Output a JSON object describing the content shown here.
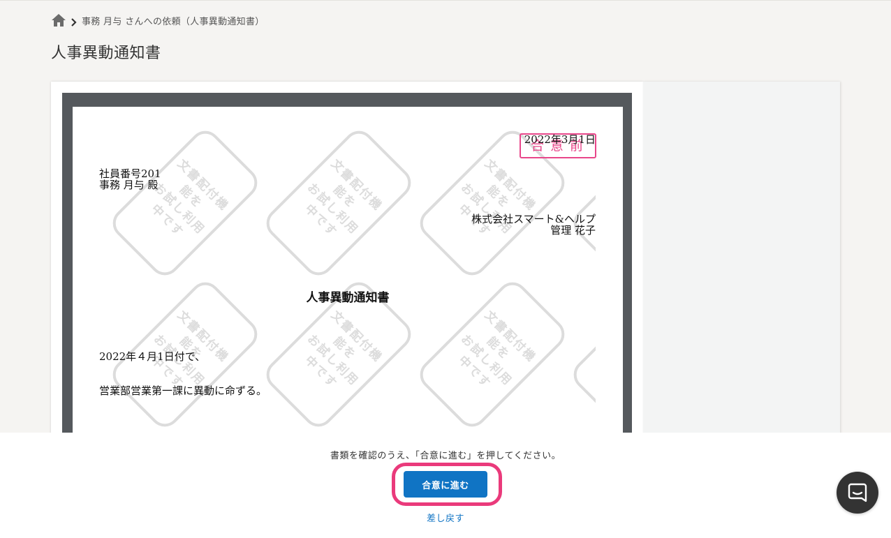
{
  "breadcrumb": {
    "home_icon": "home-icon",
    "separator_icon": "chevron-right-icon",
    "current": "事務 月与 さんへの依頼（人事異動通知書）"
  },
  "page": {
    "title": "人事異動通知書"
  },
  "document": {
    "stamp": "合意前",
    "date": "2022年3月1日",
    "employee_number": "社員番号201",
    "employee_name": "事務 月与 殿",
    "company": "株式会社スマート&ヘルプ",
    "manager": "管理 花子",
    "heading": "人事異動通知書",
    "effective_date_line": "2022年４月1日付で、",
    "order_line": "営業部営業第一課に異動に命ずる。",
    "watermark_line1": "文書配付機能を",
    "watermark_line2": "お試し利用中です",
    "stamp_color": "#e8468a"
  },
  "footer": {
    "message": "書類を確認のうえ、「合意に進む」を押してください。",
    "agree_button": "合意に進む",
    "return_link": "差し戻す",
    "accent_color": "#1074c4",
    "highlight_color": "#ea3a7b"
  },
  "chat": {
    "icon": "chat-bubble-icon"
  }
}
